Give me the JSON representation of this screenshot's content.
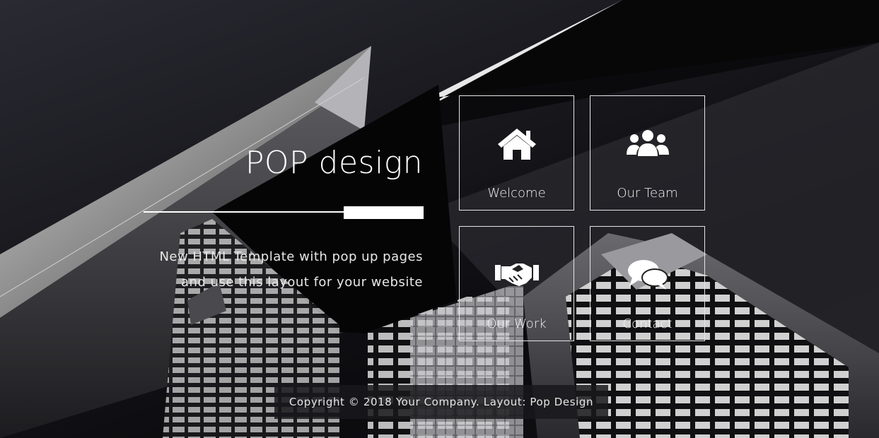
{
  "brand": {
    "title": "POP design",
    "tagline_line1": "New HTML Template with pop up pages",
    "tagline_line2": "and use this layout for your website"
  },
  "nav": {
    "tiles": [
      {
        "label": "Welcome",
        "icon": "home-icon"
      },
      {
        "label": "Our Team",
        "icon": "users-icon"
      },
      {
        "label": "Our Work",
        "icon": "handshake-icon"
      },
      {
        "label": "Contact",
        "icon": "comments-icon"
      }
    ]
  },
  "footer": {
    "copyright": "Copyright © 2018 Your Company. Layout: Pop Design"
  },
  "colors": {
    "background": "#0b0b0e",
    "text": "#ffffff",
    "tile_border": "#e6e6e6"
  }
}
